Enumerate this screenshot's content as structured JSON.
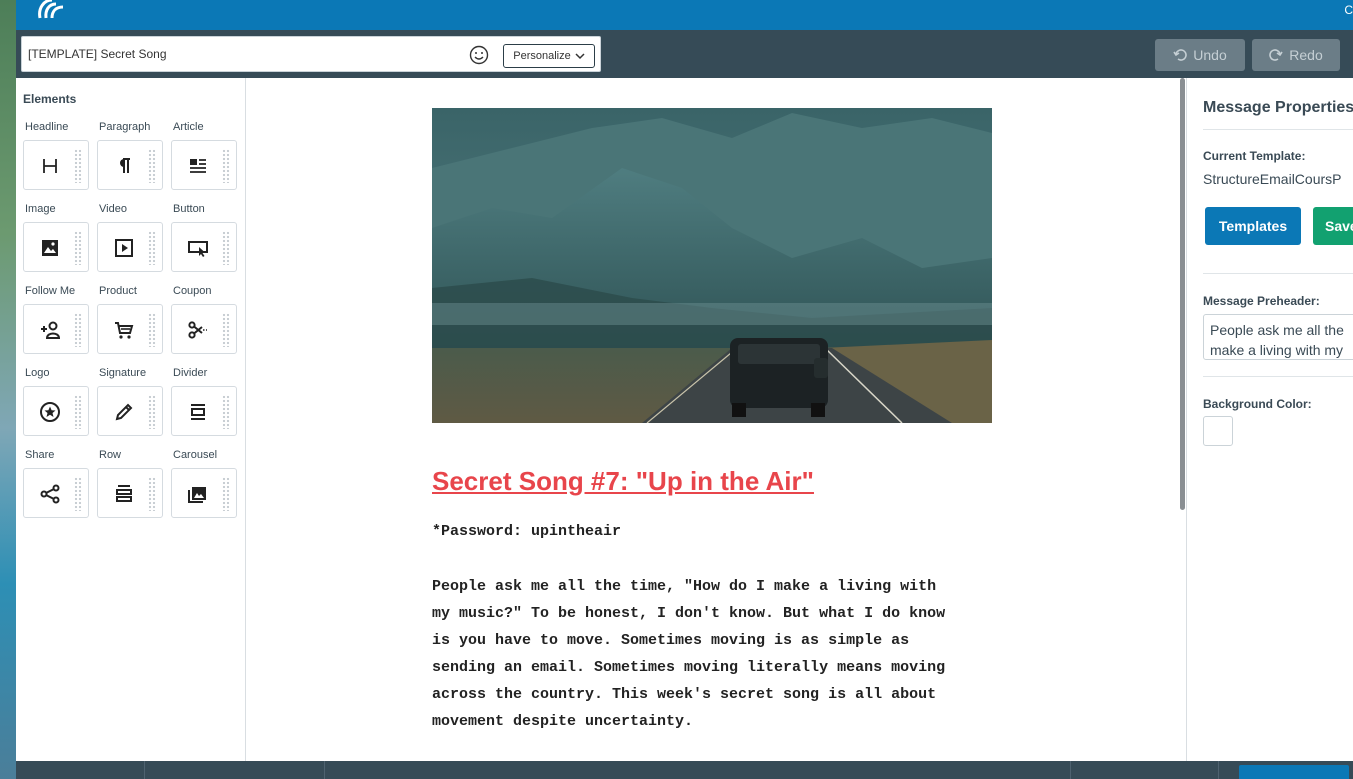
{
  "toolbar": {
    "subject": "[TEMPLATE] Secret Song",
    "personalize_label": "Personalize",
    "undo_label": "Undo",
    "redo_label": "Redo"
  },
  "elements_panel": {
    "title": "Elements",
    "items": [
      {
        "label": "Headline",
        "icon": "headline-icon"
      },
      {
        "label": "Paragraph",
        "icon": "paragraph-icon"
      },
      {
        "label": "Article",
        "icon": "article-icon"
      },
      {
        "label": "Image",
        "icon": "image-icon"
      },
      {
        "label": "Video",
        "icon": "video-icon"
      },
      {
        "label": "Button",
        "icon": "button-icon"
      },
      {
        "label": "Follow Me",
        "icon": "follow-me-icon"
      },
      {
        "label": "Product",
        "icon": "cart-icon"
      },
      {
        "label": "Coupon",
        "icon": "scissors-icon"
      },
      {
        "label": "Logo",
        "icon": "star-badge-icon"
      },
      {
        "label": "Signature",
        "icon": "pen-icon"
      },
      {
        "label": "Divider",
        "icon": "divider-icon"
      },
      {
        "label": "Share",
        "icon": "share-icon"
      },
      {
        "label": "Row",
        "icon": "row-icon"
      },
      {
        "label": "Carousel",
        "icon": "carousel-icon"
      }
    ]
  },
  "email": {
    "heading": "Secret Song #7: \"Up in the Air\"",
    "password_line": "*Password: upintheair",
    "body_lines": [
      "People ask me all the time, \"How do I make a living with",
      "my music?\" To be honest, I don't know. But what I do know",
      "is you have to move. Sometimes moving is as simple as",
      "sending an email. Sometimes moving literally means moving",
      "across the country. This week's secret song is all about",
      "movement despite uncertainty."
    ]
  },
  "properties": {
    "title": "Message Properties",
    "current_template_label": "Current Template:",
    "current_template_value": "StructureEmailCoursP",
    "templates_button": "Templates",
    "save_button": "Save",
    "preheader_label": "Message Preheader:",
    "preheader_lines": [
      "People ask me all the",
      "make a living with my"
    ],
    "background_color_label": "Background Color:",
    "background_color": "#ffffff"
  },
  "colors": {
    "topbar": "#0b78b6",
    "toolbar": "#364b57",
    "heading_red": "#e8454b",
    "templates_blue": "#0b78b6",
    "save_green": "#12a170"
  }
}
